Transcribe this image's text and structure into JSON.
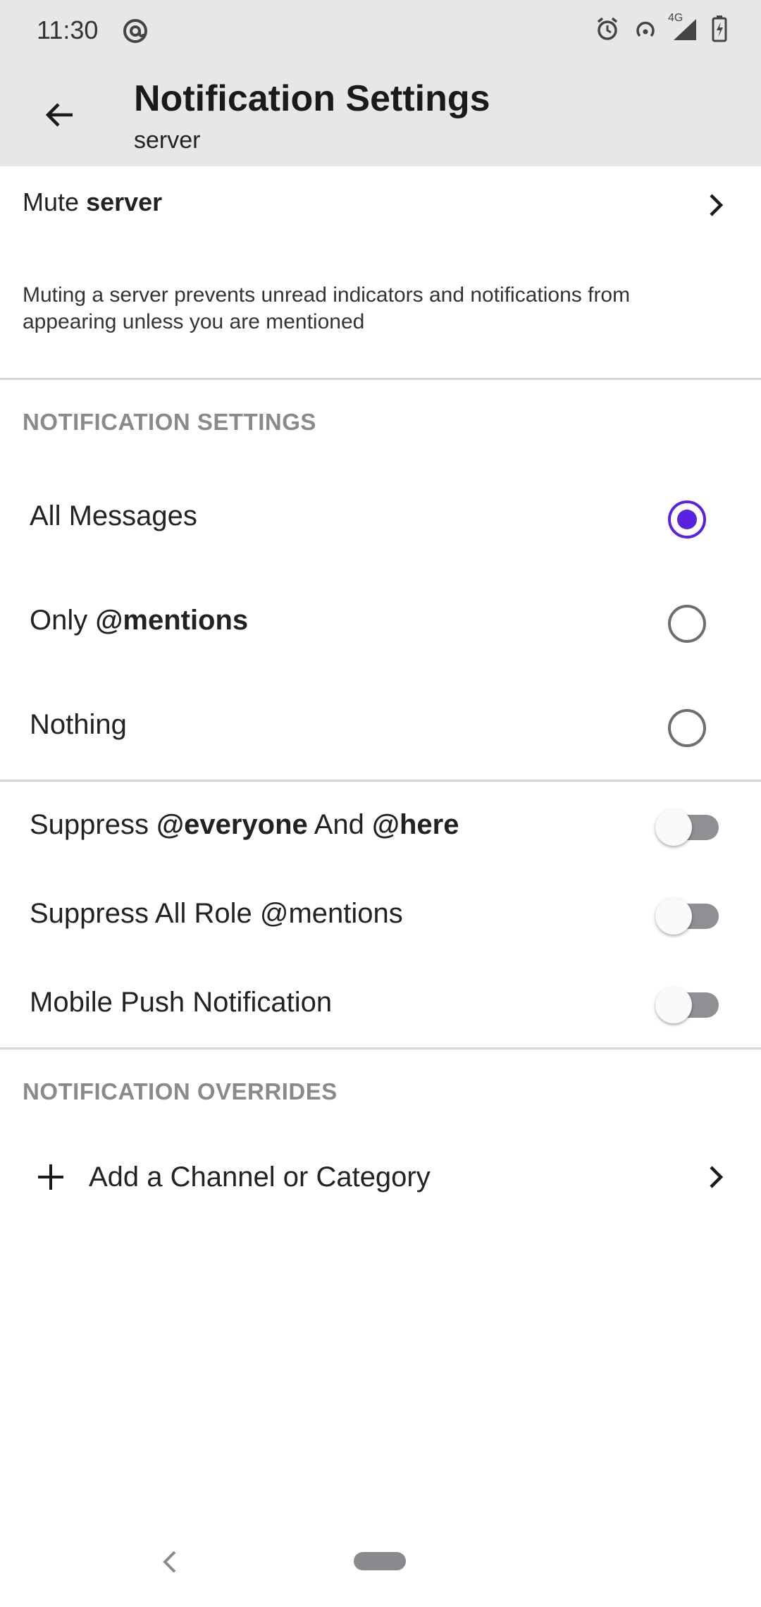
{
  "status_bar": {
    "time": "11:30",
    "icons": [
      "at-icon",
      "alarm-icon",
      "hotspot-icon",
      "signal-icon",
      "battery-icon"
    ],
    "network": "4G"
  },
  "app_bar": {
    "title": "Notification Settings",
    "subtitle": "server"
  },
  "mute": {
    "prefix": "Mute",
    "name": "server",
    "description": "Muting a server prevents unread indicators and notifications from appearing unless you are mentioned"
  },
  "notification_settings": {
    "header": "NOTIFICATION SETTINGS",
    "options": [
      {
        "label": "All Messages",
        "selected": true
      },
      {
        "label_prefix": "Only",
        "label_bold": "@mentions",
        "selected": false
      },
      {
        "label": "Nothing",
        "selected": false
      }
    ]
  },
  "toggles": [
    {
      "prefix": "Suppress",
      "bold1": "@everyone",
      "mid": "And",
      "bold2": "@here",
      "on": false
    },
    {
      "label": "Suppress All Role @mentions",
      "on": false
    },
    {
      "label": "Mobile Push Notification",
      "on": false
    }
  ],
  "overrides": {
    "header": "NOTIFICATION OVERRIDES",
    "add_label": "Add a Channel or Category"
  },
  "colors": {
    "accent": "#5b21e0",
    "header_bg": "#e7e7e9",
    "section_header": "#8a8a8e"
  }
}
